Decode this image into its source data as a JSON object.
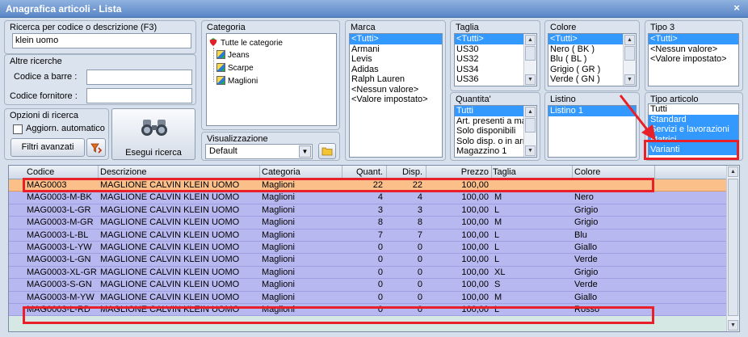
{
  "window": {
    "title": "Anagrafica articoli  - Lista",
    "close_glyph": "×"
  },
  "search": {
    "legend": "Ricerca per codice o descrizione (F3)",
    "value": "klein uomo",
    "other_legend": "Altre ricerche",
    "barcode_label": "Codice a barre :",
    "barcode_value": "",
    "supplier_label": "Codice fornitore :",
    "supplier_value": "",
    "options_legend": "Opzioni di ricerca",
    "auto_update_label": "Aggiorn. automatico",
    "advanced_filters_label": "Filtri avanzati",
    "run_search_label": "Esegui ricerca"
  },
  "categoria": {
    "legend": "Categoria",
    "root": "Tutte le categorie",
    "items": [
      "Jeans",
      "Scarpe",
      "Maglioni"
    ]
  },
  "visualizzazione": {
    "legend": "Visualizzazione",
    "selected": "Default"
  },
  "marca": {
    "legend": "Marca",
    "items": [
      "<Tutti>",
      "Armani",
      "Levis",
      "Adidas",
      "Ralph Lauren",
      "<Nessun valore>",
      "<Valore impostato>"
    ],
    "selected": [
      0
    ]
  },
  "taglia": {
    "legend": "Taglia",
    "items": [
      "<Tutti>",
      "US30",
      "US32",
      "US34",
      "US36"
    ],
    "selected": [
      0
    ]
  },
  "colore": {
    "legend": "Colore",
    "items": [
      "<Tutti>",
      "Nero ( BK )",
      "Blu ( BL )",
      "Grigio ( GR )",
      "Verde ( GN )"
    ],
    "selected": [
      0
    ]
  },
  "tipo3": {
    "legend": "Tipo 3",
    "items": [
      "<Tutti>",
      "<Nessun valore>",
      "<Valore impostato>"
    ],
    "selected": [
      0
    ]
  },
  "quantita": {
    "legend": "Quantita'",
    "items": [
      "Tutti",
      "Art. presenti a ma",
      "Solo disponibili",
      "Solo disp. o in arr",
      "Magazzino 1"
    ],
    "selected": [
      0
    ]
  },
  "listino": {
    "legend": "Listino",
    "items": [
      "Listino 1"
    ],
    "selected": [
      0
    ]
  },
  "tipo_articolo": {
    "legend": "Tipo articolo",
    "items": [
      "Tutti",
      "Standard",
      "Servizi e lavorazioni",
      "Matrici",
      "Varianti"
    ],
    "selected": [
      1,
      2,
      3,
      4
    ]
  },
  "grid": {
    "columns": {
      "codice": "Codice",
      "descrizione": "Descrizione",
      "categoria": "Categoria",
      "quant": "Quant.",
      "disp": "Disp.",
      "prezzo": "Prezzo",
      "taglia": "Taglia",
      "colore": "Colore"
    },
    "rows": [
      {
        "codice": "MAG0003",
        "descrizione": "MAGLIONE CALVIN KLEIN UOMO",
        "categoria": "Maglioni",
        "quant": "22",
        "disp": "22",
        "prezzo": "100,00",
        "taglia": "",
        "colore": ""
      },
      {
        "codice": "MAG0003-M-BK",
        "descrizione": "MAGLIONE CALVIN KLEIN UOMO",
        "categoria": "Maglioni",
        "quant": "4",
        "disp": "4",
        "prezzo": "100,00",
        "taglia": "M",
        "colore": "Nero"
      },
      {
        "codice": "MAG0003-L-GR",
        "descrizione": "MAGLIONE CALVIN KLEIN UOMO",
        "categoria": "Maglioni",
        "quant": "3",
        "disp": "3",
        "prezzo": "100,00",
        "taglia": "L",
        "colore": "Grigio"
      },
      {
        "codice": "MAG0003-M-GR",
        "descrizione": "MAGLIONE CALVIN KLEIN UOMO",
        "categoria": "Maglioni",
        "quant": "8",
        "disp": "8",
        "prezzo": "100,00",
        "taglia": "M",
        "colore": "Grigio"
      },
      {
        "codice": "MAG0003-L-BL",
        "descrizione": "MAGLIONE CALVIN KLEIN UOMO",
        "categoria": "Maglioni",
        "quant": "7",
        "disp": "7",
        "prezzo": "100,00",
        "taglia": "L",
        "colore": "Blu"
      },
      {
        "codice": "MAG0003-L-YW",
        "descrizione": "MAGLIONE CALVIN KLEIN UOMO",
        "categoria": "Maglioni",
        "quant": "0",
        "disp": "0",
        "prezzo": "100,00",
        "taglia": "L",
        "colore": "Giallo"
      },
      {
        "codice": "MAG0003-L-GN",
        "descrizione": "MAGLIONE CALVIN KLEIN UOMO",
        "categoria": "Maglioni",
        "quant": "0",
        "disp": "0",
        "prezzo": "100,00",
        "taglia": "L",
        "colore": "Verde"
      },
      {
        "codice": "MAG0003-XL-GR",
        "descrizione": "MAGLIONE CALVIN KLEIN UOMO",
        "categoria": "Maglioni",
        "quant": "0",
        "disp": "0",
        "prezzo": "100,00",
        "taglia": "XL",
        "colore": "Grigio"
      },
      {
        "codice": "MAG0003-S-GN",
        "descrizione": "MAGLIONE CALVIN KLEIN UOMO",
        "categoria": "Maglioni",
        "quant": "0",
        "disp": "0",
        "prezzo": "100,00",
        "taglia": "S",
        "colore": "Verde"
      },
      {
        "codice": "MAG0003-M-YW",
        "descrizione": "MAGLIONE CALVIN KLEIN UOMO",
        "categoria": "Maglioni",
        "quant": "0",
        "disp": "0",
        "prezzo": "100,00",
        "taglia": "M",
        "colore": "Giallo"
      },
      {
        "codice": "MAG0003-L-RD",
        "descrizione": "MAGLIONE CALVIN KLEIN UOMO",
        "categoria": "Maglioni",
        "quant": "0",
        "disp": "0",
        "prezzo": "100,00",
        "taglia": "L",
        "colore": "Rosso"
      }
    ],
    "highlighted_row": 0
  },
  "colors": {
    "row_bg": "#b8b8f0",
    "highlight_row_bg": "#fbbf8a",
    "selection": "#3399ff",
    "annotation": "#e8202a",
    "title_bar": "#5a86c6"
  },
  "icons": {
    "close": "close-icon",
    "binoculars": "binoculars-icon",
    "filter": "funnel-icon",
    "folder": "folder-icon",
    "category_root": "strawberry-icon",
    "category_node": "cube-icon"
  }
}
